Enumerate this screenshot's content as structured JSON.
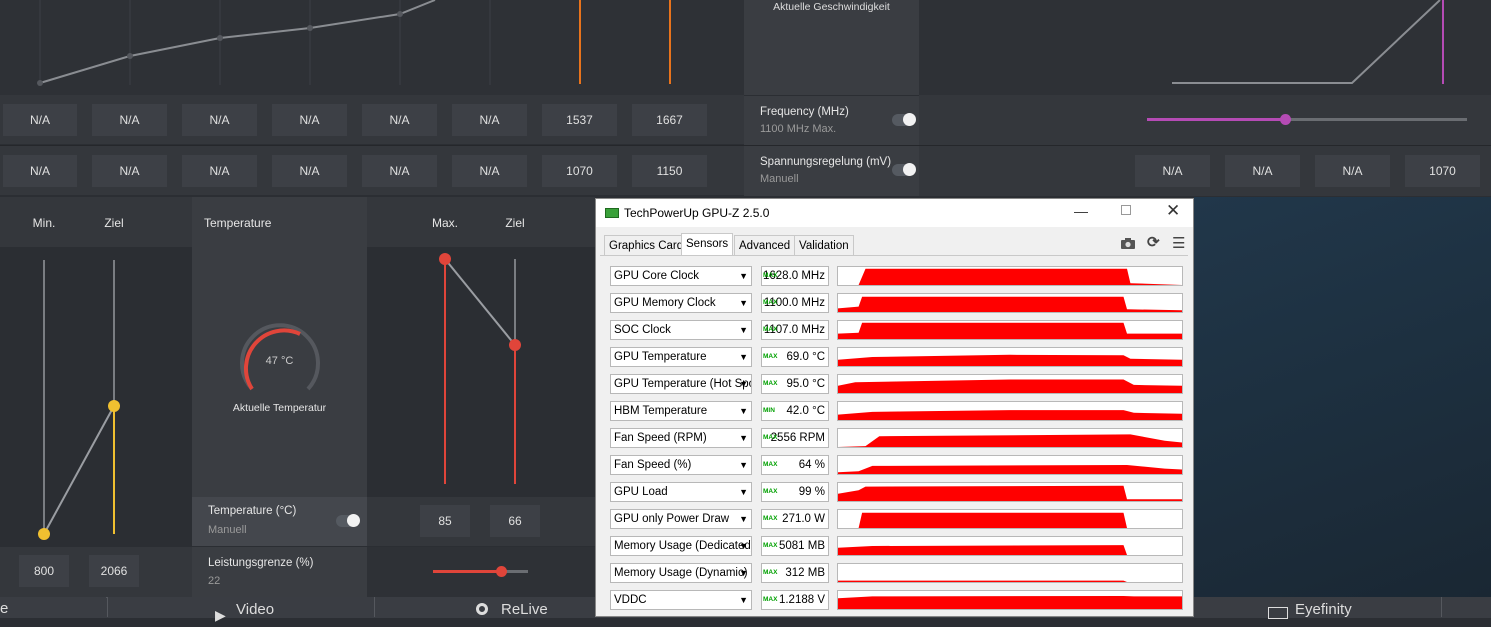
{
  "top": {
    "speed_label": "Aktuelle Geschwindigkeit",
    "row1_values": [
      "N/A",
      "N/A",
      "N/A",
      "N/A",
      "N/A",
      "N/A",
      "1537",
      "1667"
    ],
    "row2_values": [
      "N/A",
      "N/A",
      "N/A",
      "N/A",
      "N/A",
      "N/A",
      "1070",
      "1150"
    ],
    "frequency": {
      "title": "Frequency (MHz)",
      "sub": "1100 MHz Max."
    },
    "voltage": {
      "title": "Spannungsregelung (mV)",
      "sub": "Manuell"
    },
    "right_values": [
      "N/A",
      "N/A",
      "N/A",
      "1070"
    ],
    "frequency_slider_level": 0.43
  },
  "fan": {
    "min_label": "Min.",
    "target_label": "Ziel",
    "min_value": "800",
    "target_value": "2066"
  },
  "temperature": {
    "header": "Temperature",
    "gauge_value": "47 °C",
    "gauge_label": "Aktuelle Temperatur",
    "max_label": "Max.",
    "target_label": "Ziel",
    "max_value": "85",
    "target_value": "66",
    "control_title": "Temperature (°C)",
    "control_sub": "Manuell",
    "power_title": "Leistungsgrenze (%)",
    "power_sub": "22",
    "power_slider_level": 0.72
  },
  "bottom_tabs": [
    "e",
    "Video",
    "ReLive",
    "Eyefinity"
  ],
  "gpuz": {
    "title": "TechPowerUp GPU-Z 2.5.0",
    "tabs": [
      "Graphics Card",
      "Sensors",
      "Advanced",
      "Validation"
    ],
    "active_tab": "Sensors",
    "colors": {
      "graph": "#ff0000",
      "tag": "#00a000"
    },
    "sensors": [
      {
        "name": "GPU Core Clock",
        "tag": "MAX",
        "value": "1628.0 MHz"
      },
      {
        "name": "GPU Memory Clock",
        "tag": "MAX",
        "value": "1100.0 MHz"
      },
      {
        "name": "SOC Clock",
        "tag": "MAX",
        "value": "1107.0 MHz"
      },
      {
        "name": "GPU Temperature",
        "tag": "MAX",
        "value": "69.0 °C"
      },
      {
        "name": "GPU Temperature (Hot Spot)",
        "tag": "MAX",
        "value": "95.0 °C"
      },
      {
        "name": "HBM Temperature",
        "tag": "MIN",
        "value": "42.0 °C"
      },
      {
        "name": "Fan Speed (RPM)",
        "tag": "MAX",
        "value": "2556 RPM"
      },
      {
        "name": "Fan Speed (%)",
        "tag": "MAX",
        "value": "64 %"
      },
      {
        "name": "GPU Load",
        "tag": "MAX",
        "value": "99 %"
      },
      {
        "name": "GPU only Power Draw",
        "tag": "MAX",
        "value": "271.0 W"
      },
      {
        "name": "Memory Usage (Dedicated)",
        "tag": "MAX",
        "value": "5081 MB"
      },
      {
        "name": "Memory Usage (Dynamic)",
        "tag": "MAX",
        "value": "312 MB"
      },
      {
        "name": "VDDC",
        "tag": "MAX",
        "value": "1.2188 V"
      }
    ]
  }
}
